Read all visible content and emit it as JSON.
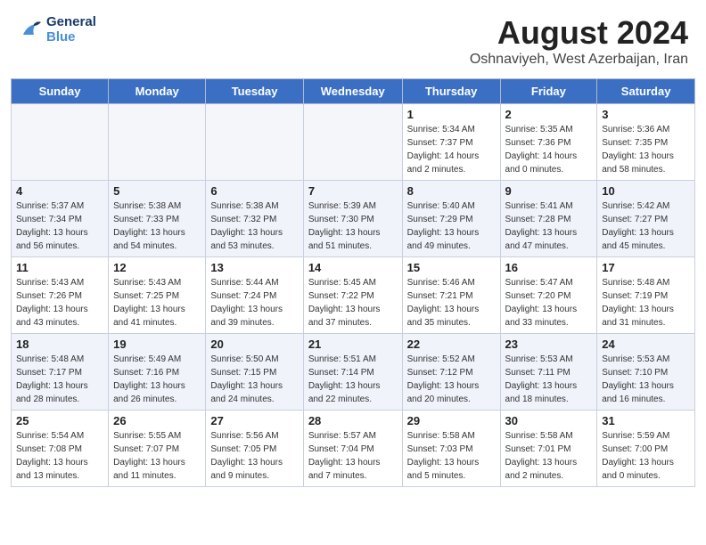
{
  "header": {
    "logo_line1": "General",
    "logo_line2": "Blue",
    "month": "August 2024",
    "location": "Oshnaviyeh, West Azerbaijan, Iran"
  },
  "weekdays": [
    "Sunday",
    "Monday",
    "Tuesday",
    "Wednesday",
    "Thursday",
    "Friday",
    "Saturday"
  ],
  "weeks": [
    [
      {
        "day": "",
        "info": ""
      },
      {
        "day": "",
        "info": ""
      },
      {
        "day": "",
        "info": ""
      },
      {
        "day": "",
        "info": ""
      },
      {
        "day": "1",
        "info": "Sunrise: 5:34 AM\nSunset: 7:37 PM\nDaylight: 14 hours\nand 2 minutes."
      },
      {
        "day": "2",
        "info": "Sunrise: 5:35 AM\nSunset: 7:36 PM\nDaylight: 14 hours\nand 0 minutes."
      },
      {
        "day": "3",
        "info": "Sunrise: 5:36 AM\nSunset: 7:35 PM\nDaylight: 13 hours\nand 58 minutes."
      }
    ],
    [
      {
        "day": "4",
        "info": "Sunrise: 5:37 AM\nSunset: 7:34 PM\nDaylight: 13 hours\nand 56 minutes."
      },
      {
        "day": "5",
        "info": "Sunrise: 5:38 AM\nSunset: 7:33 PM\nDaylight: 13 hours\nand 54 minutes."
      },
      {
        "day": "6",
        "info": "Sunrise: 5:38 AM\nSunset: 7:32 PM\nDaylight: 13 hours\nand 53 minutes."
      },
      {
        "day": "7",
        "info": "Sunrise: 5:39 AM\nSunset: 7:30 PM\nDaylight: 13 hours\nand 51 minutes."
      },
      {
        "day": "8",
        "info": "Sunrise: 5:40 AM\nSunset: 7:29 PM\nDaylight: 13 hours\nand 49 minutes."
      },
      {
        "day": "9",
        "info": "Sunrise: 5:41 AM\nSunset: 7:28 PM\nDaylight: 13 hours\nand 47 minutes."
      },
      {
        "day": "10",
        "info": "Sunrise: 5:42 AM\nSunset: 7:27 PM\nDaylight: 13 hours\nand 45 minutes."
      }
    ],
    [
      {
        "day": "11",
        "info": "Sunrise: 5:43 AM\nSunset: 7:26 PM\nDaylight: 13 hours\nand 43 minutes."
      },
      {
        "day": "12",
        "info": "Sunrise: 5:43 AM\nSunset: 7:25 PM\nDaylight: 13 hours\nand 41 minutes."
      },
      {
        "day": "13",
        "info": "Sunrise: 5:44 AM\nSunset: 7:24 PM\nDaylight: 13 hours\nand 39 minutes."
      },
      {
        "day": "14",
        "info": "Sunrise: 5:45 AM\nSunset: 7:22 PM\nDaylight: 13 hours\nand 37 minutes."
      },
      {
        "day": "15",
        "info": "Sunrise: 5:46 AM\nSunset: 7:21 PM\nDaylight: 13 hours\nand 35 minutes."
      },
      {
        "day": "16",
        "info": "Sunrise: 5:47 AM\nSunset: 7:20 PM\nDaylight: 13 hours\nand 33 minutes."
      },
      {
        "day": "17",
        "info": "Sunrise: 5:48 AM\nSunset: 7:19 PM\nDaylight: 13 hours\nand 31 minutes."
      }
    ],
    [
      {
        "day": "18",
        "info": "Sunrise: 5:48 AM\nSunset: 7:17 PM\nDaylight: 13 hours\nand 28 minutes."
      },
      {
        "day": "19",
        "info": "Sunrise: 5:49 AM\nSunset: 7:16 PM\nDaylight: 13 hours\nand 26 minutes."
      },
      {
        "day": "20",
        "info": "Sunrise: 5:50 AM\nSunset: 7:15 PM\nDaylight: 13 hours\nand 24 minutes."
      },
      {
        "day": "21",
        "info": "Sunrise: 5:51 AM\nSunset: 7:14 PM\nDaylight: 13 hours\nand 22 minutes."
      },
      {
        "day": "22",
        "info": "Sunrise: 5:52 AM\nSunset: 7:12 PM\nDaylight: 13 hours\nand 20 minutes."
      },
      {
        "day": "23",
        "info": "Sunrise: 5:53 AM\nSunset: 7:11 PM\nDaylight: 13 hours\nand 18 minutes."
      },
      {
        "day": "24",
        "info": "Sunrise: 5:53 AM\nSunset: 7:10 PM\nDaylight: 13 hours\nand 16 minutes."
      }
    ],
    [
      {
        "day": "25",
        "info": "Sunrise: 5:54 AM\nSunset: 7:08 PM\nDaylight: 13 hours\nand 13 minutes."
      },
      {
        "day": "26",
        "info": "Sunrise: 5:55 AM\nSunset: 7:07 PM\nDaylight: 13 hours\nand 11 minutes."
      },
      {
        "day": "27",
        "info": "Sunrise: 5:56 AM\nSunset: 7:05 PM\nDaylight: 13 hours\nand 9 minutes."
      },
      {
        "day": "28",
        "info": "Sunrise: 5:57 AM\nSunset: 7:04 PM\nDaylight: 13 hours\nand 7 minutes."
      },
      {
        "day": "29",
        "info": "Sunrise: 5:58 AM\nSunset: 7:03 PM\nDaylight: 13 hours\nand 5 minutes."
      },
      {
        "day": "30",
        "info": "Sunrise: 5:58 AM\nSunset: 7:01 PM\nDaylight: 13 hours\nand 2 minutes."
      },
      {
        "day": "31",
        "info": "Sunrise: 5:59 AM\nSunset: 7:00 PM\nDaylight: 13 hours\nand 0 minutes."
      }
    ]
  ]
}
